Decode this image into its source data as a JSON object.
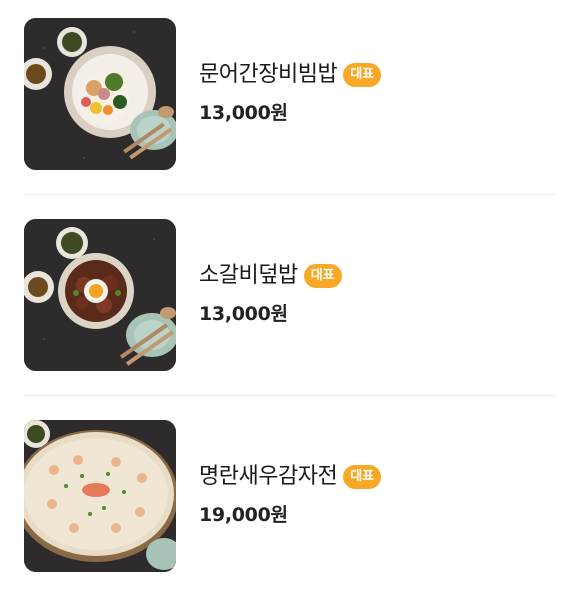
{
  "menu": {
    "items": [
      {
        "name": "문어간장비빔밥",
        "badge": "대표",
        "price": "13,000원",
        "image": "octopus-soy-bibimbap-photo"
      },
      {
        "name": "소갈비덮밥",
        "badge": "대표",
        "price": "13,000원",
        "image": "beef-rib-rice-bowl-photo"
      },
      {
        "name": "명란새우감자전",
        "badge": "대표",
        "price": "19,000원",
        "image": "pollock-roe-shrimp-potato-pancake-photo"
      }
    ]
  },
  "colors": {
    "badge_background": "#f9a825",
    "badge_text": "#ffffff",
    "divider": "#ececec"
  }
}
